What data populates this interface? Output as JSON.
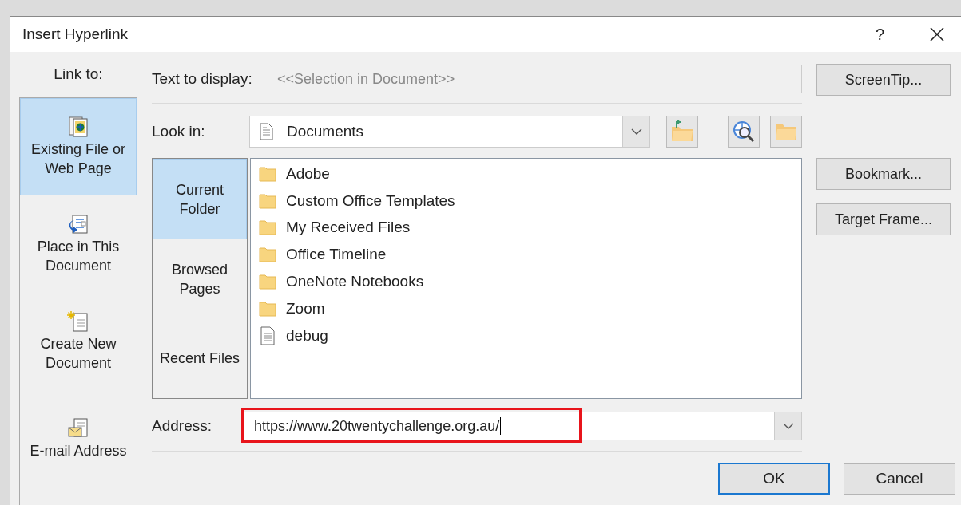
{
  "window": {
    "title": "Insert Hyperlink",
    "help": "?"
  },
  "link_to": {
    "label": "Link to:",
    "items": [
      {
        "label": "Existing File or Web Page",
        "kind": "web-file",
        "selected": true
      },
      {
        "label": "Place in This Document",
        "kind": "place",
        "selected": false
      },
      {
        "label": "Create New Document",
        "kind": "new-doc",
        "selected": false
      },
      {
        "label": "E-mail Address",
        "kind": "email",
        "selected": false
      }
    ]
  },
  "text_to_display": {
    "label": "Text to display:",
    "value": "<<Selection in Document>>",
    "disabled": true
  },
  "look_in": {
    "label": "Look in:",
    "value": "Documents"
  },
  "browse_tabs": [
    {
      "label": "Current Folder",
      "selected": true
    },
    {
      "label": "Browsed Pages",
      "selected": false
    },
    {
      "label": "Recent Files",
      "selected": false
    }
  ],
  "files": [
    {
      "name": "Adobe",
      "kind": "folder"
    },
    {
      "name": "Custom Office Templates",
      "kind": "folder"
    },
    {
      "name": "My Received Files",
      "kind": "folder"
    },
    {
      "name": "Office Timeline",
      "kind": "folder"
    },
    {
      "name": "OneNote Notebooks",
      "kind": "folder"
    },
    {
      "name": "Zoom",
      "kind": "folder"
    },
    {
      "name": "debug",
      "kind": "file"
    }
  ],
  "address": {
    "label": "Address:",
    "value": "https://www.20twentychallenge.org.au/",
    "highlighted": true
  },
  "side_buttons": [
    "ScreenTip...",
    "Bookmark...",
    "Target Frame..."
  ],
  "footer_buttons": [
    {
      "label": "OK",
      "default": true
    },
    {
      "label": "Cancel",
      "default": false
    }
  ]
}
